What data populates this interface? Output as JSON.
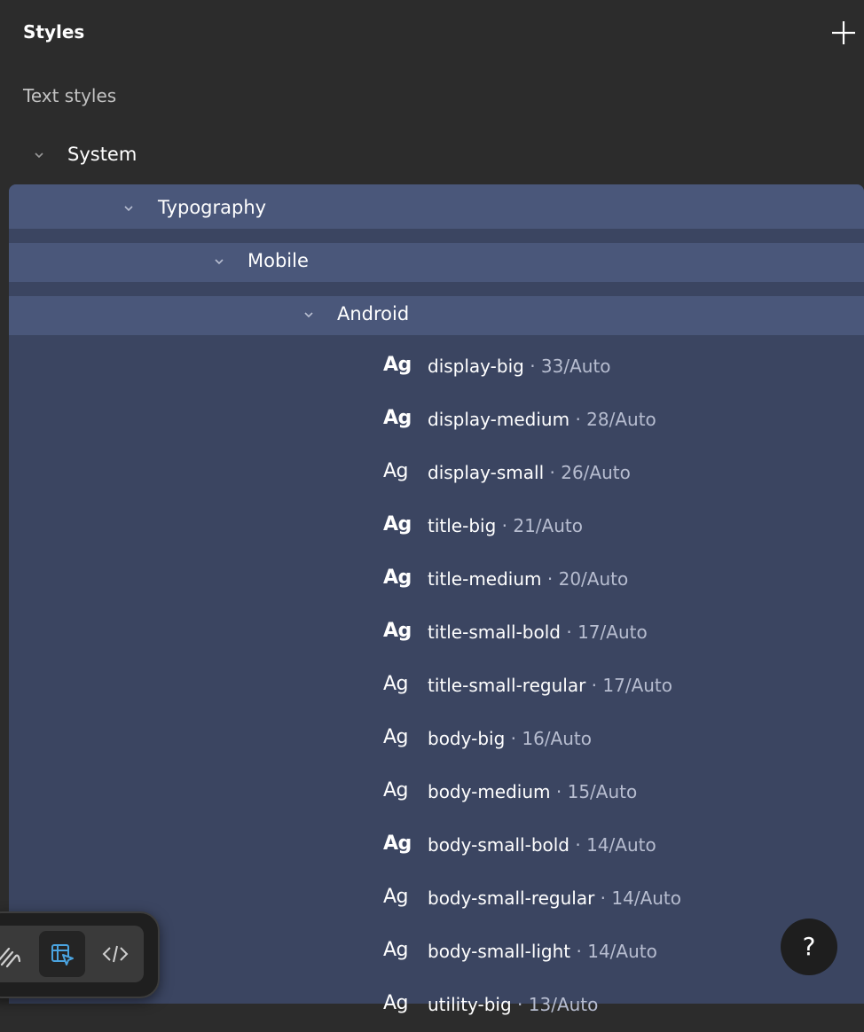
{
  "panel": {
    "title": "Styles"
  },
  "section": {
    "title": "Text styles"
  },
  "groups": [
    {
      "label": "System"
    },
    {
      "label": "Typography"
    },
    {
      "label": "Mobile"
    },
    {
      "label": "Android"
    }
  ],
  "icons": {
    "add": "plus-icon",
    "chevron": "chevron-down-icon",
    "type_preview": "Ag",
    "toolbar": [
      "draw-icon",
      "design-mode-icon",
      "code-icon"
    ],
    "help": "?"
  },
  "styles": [
    {
      "name": "display-big",
      "meta": "· 33/Auto",
      "weight": "bold"
    },
    {
      "name": "display-medium",
      "meta": "· 28/Auto",
      "weight": "bold"
    },
    {
      "name": "display-small",
      "meta": "· 26/Auto",
      "weight": "regular"
    },
    {
      "name": "title-big",
      "meta": "· 21/Auto",
      "weight": "bold"
    },
    {
      "name": "title-medium",
      "meta": "· 20/Auto",
      "weight": "bold"
    },
    {
      "name": "title-small-bold",
      "meta": "· 17/Auto",
      "weight": "bold"
    },
    {
      "name": "title-small-regular",
      "meta": "· 17/Auto",
      "weight": "regular"
    },
    {
      "name": "body-big",
      "meta": "· 16/Auto",
      "weight": "regular"
    },
    {
      "name": "body-medium",
      "meta": "· 15/Auto",
      "weight": "regular"
    },
    {
      "name": "body-small-bold",
      "meta": "· 14/Auto",
      "weight": "bold"
    },
    {
      "name": "body-small-regular",
      "meta": "· 14/Auto",
      "weight": "regular"
    },
    {
      "name": "body-small-light",
      "meta": "· 14/Auto",
      "weight": "regular"
    },
    {
      "name": "utility-big",
      "meta": "· 13/Auto",
      "weight": "regular"
    }
  ],
  "colors": {
    "background": "#2c2c2c",
    "selection": "#3b4561",
    "selection_header": "#4a577a",
    "accent_icon": "#4aa3df"
  }
}
